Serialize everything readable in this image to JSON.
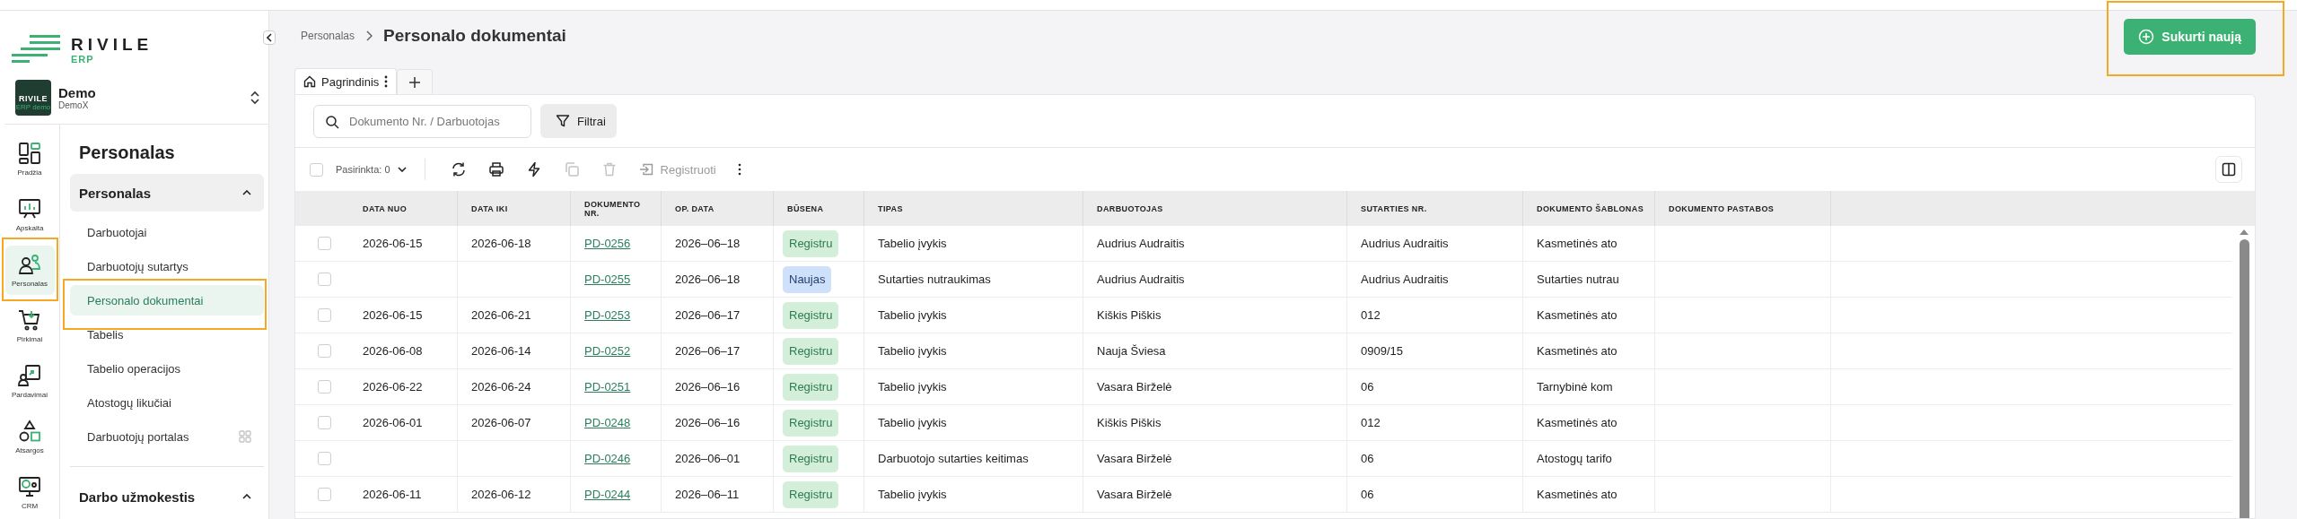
{
  "brand": {
    "name": "RIVILE",
    "sub": "ERP"
  },
  "workspace": {
    "name": "Demo",
    "sub": "DemoX",
    "logo_name": "RIVILE",
    "logo_sub": "ERP demo"
  },
  "rail": [
    {
      "kind": "home",
      "label": "Pradžia",
      "selected": false,
      "highlighted": false
    },
    {
      "kind": "chart",
      "label": "Apskaita",
      "selected": false,
      "highlighted": false
    },
    {
      "kind": "people",
      "label": "Personalas",
      "selected": true,
      "highlighted": true
    },
    {
      "kind": "cart",
      "label": "Pirkimai",
      "selected": false,
      "highlighted": false
    },
    {
      "kind": "sales",
      "label": "Pardavimai",
      "selected": false,
      "highlighted": false
    },
    {
      "kind": "shapes",
      "label": "Atsargos",
      "selected": false,
      "highlighted": false
    },
    {
      "kind": "crm",
      "label": "CRM",
      "selected": false,
      "highlighted": false
    }
  ],
  "nav": {
    "title": "Personalas",
    "groups": [
      {
        "label": "Personalas",
        "expanded": true,
        "items": [
          {
            "label": "Darbuotojai",
            "selected": false,
            "highlighted": false,
            "app": false
          },
          {
            "label": "Darbuotojų sutartys",
            "selected": false,
            "highlighted": false,
            "app": false
          },
          {
            "label": "Personalo dokumentai",
            "selected": true,
            "highlighted": true,
            "app": false
          },
          {
            "label": "Tabelis",
            "selected": false,
            "highlighted": false,
            "app": false
          },
          {
            "label": "Tabelio operacijos",
            "selected": false,
            "highlighted": false,
            "app": false
          },
          {
            "label": "Atostogų likučiai",
            "selected": false,
            "highlighted": false,
            "app": false
          },
          {
            "label": "Darbuotojų portalas",
            "selected": false,
            "highlighted": false,
            "app": true
          }
        ]
      },
      {
        "label": "Darbo užmokestis",
        "expanded": true
      }
    ]
  },
  "breadcrumb": {
    "parent": "Personalas",
    "title": "Personalo dokumentai"
  },
  "create_button": {
    "label": "Sukurti naują",
    "highlighted": true
  },
  "view_tabs": [
    {
      "label": "Pagrindinis",
      "selected": true
    }
  ],
  "search": {
    "placeholder": "Dokumento Nr. / Darbuotojas"
  },
  "filter_button": {
    "label": "Filtrai"
  },
  "toolbar": {
    "select_all_checked": false,
    "selection": "Pasirinkta: 0",
    "actions": [
      {
        "kind": "refresh",
        "disabled": false
      },
      {
        "kind": "print",
        "disabled": false
      },
      {
        "kind": "bolt",
        "disabled": false
      },
      {
        "kind": "copy",
        "disabled": true
      },
      {
        "kind": "delete",
        "disabled": true
      },
      {
        "kind": "register",
        "label": "Registruoti",
        "disabled": true
      },
      {
        "kind": "more",
        "disabled": false
      }
    ]
  },
  "table": {
    "columns": [
      "DATA NUO",
      "DATA IKI",
      "DOKUMENTO NR.",
      "OP. DATA",
      "BŪSENA",
      "TIPAS",
      "DARBUOTOJAS",
      "SUTARTIES NR.",
      "DOKUMENTO ŠABLONAS",
      "DOKUMENTO PASTABOS"
    ],
    "rows": [
      {
        "checked": false,
        "date_from": "2026-06-15",
        "date_to": "2026-06-18",
        "doc_no": "PD-0256",
        "op_date": "2026–06–18",
        "status": {
          "label": "Registru",
          "kind": "registered"
        },
        "type": "Tabelio įvykis",
        "employee": "Audrius Audraitis",
        "contract_no": "Audrius Audraitis",
        "template": "Kasmetinės ato"
      },
      {
        "checked": false,
        "date_from": "",
        "date_to": "",
        "doc_no": "PD-0255",
        "op_date": "2026–06–18",
        "status": {
          "label": "Naujas",
          "kind": "new"
        },
        "type": "Sutarties nutraukimas",
        "employee": "Audrius Audraitis",
        "contract_no": "Audrius Audraitis",
        "template": "Sutarties nutrau"
      },
      {
        "checked": false,
        "date_from": "2026-06-15",
        "date_to": "2026-06-21",
        "doc_no": "PD-0253",
        "op_date": "2026–06–17",
        "status": {
          "label": "Registru",
          "kind": "registered"
        },
        "type": "Tabelio įvykis",
        "employee": "Kiškis Piškis",
        "contract_no": "012",
        "template": "Kasmetinės ato"
      },
      {
        "checked": false,
        "date_from": "2026-06-08",
        "date_to": "2026-06-14",
        "doc_no": "PD-0252",
        "op_date": "2026–06–17",
        "status": {
          "label": "Registru",
          "kind": "registered"
        },
        "type": "Tabelio įvykis",
        "employee": "Nauja Šviesa",
        "contract_no": "0909/15",
        "template": "Kasmetinės ato"
      },
      {
        "checked": false,
        "date_from": "2026-06-22",
        "date_to": "2026-06-24",
        "doc_no": "PD-0251",
        "op_date": "2026–06–16",
        "status": {
          "label": "Registru",
          "kind": "registered"
        },
        "type": "Tabelio įvykis",
        "employee": "Vasara Birželė",
        "contract_no": "06",
        "template": "Tarnybinė kom"
      },
      {
        "checked": false,
        "date_from": "2026-06-01",
        "date_to": "2026-06-07",
        "doc_no": "PD-0248",
        "op_date": "2026–06–16",
        "status": {
          "label": "Registru",
          "kind": "registered"
        },
        "type": "Tabelio įvykis",
        "employee": "Kiškis Piškis",
        "contract_no": "012",
        "template": "Kasmetinės ato"
      },
      {
        "checked": false,
        "date_from": "",
        "date_to": "",
        "doc_no": "PD-0246",
        "op_date": "2026–06–01",
        "status": {
          "label": "Registru",
          "kind": "registered"
        },
        "type": "Darbuotojo sutarties keitimas",
        "employee": "Vasara Birželė",
        "contract_no": "06",
        "template": "Atostogų tarifo"
      },
      {
        "checked": false,
        "date_from": "2026-06-11",
        "date_to": "2026-06-12",
        "doc_no": "PD-0244",
        "op_date": "2026–06–11",
        "status": {
          "label": "Registru",
          "kind": "registered"
        },
        "type": "Tabelio įvykis",
        "employee": "Vasara Birželė",
        "contract_no": "06",
        "template": "Kasmetinės ato"
      }
    ]
  }
}
